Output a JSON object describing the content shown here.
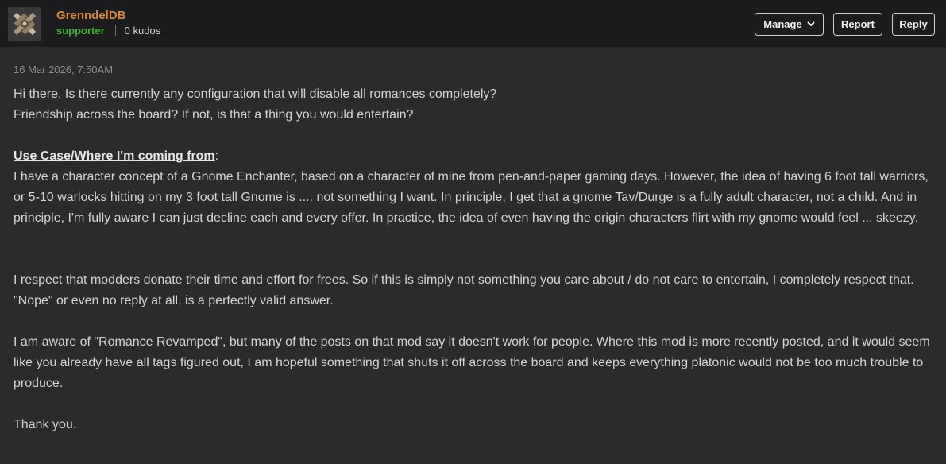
{
  "author": {
    "username": "GrenndelDB",
    "role": "supporter",
    "kudos": "0 kudos"
  },
  "actions": {
    "manage_label": "Manage",
    "report_label": "Report",
    "reply_label": "Reply"
  },
  "post": {
    "timestamp": "16 Mar 2026, 7:50AM",
    "line1": "Hi there. Is there currently any configuration that will disable all romances completely?",
    "line2": "Friendship across the board? If not, is that a thing you would entertain?",
    "heading": "Use Case/Where I'm coming from",
    "heading_suffix": ":",
    "para1": "I have a character concept of a Gnome Enchanter, based on a character of mine from pen-and-paper gaming days. However, the idea of having 6 foot tall warriors, or 5-10 warlocks hitting on my 3 foot tall Gnome is .... not something I want. In principle, I get that a gnome Tav/Durge is a fully adult character, not a child. And in principle, I'm fully aware I can just decline each and every offer. In practice, the idea of even having the origin characters flirt with my gnome would feel ... skeezy.",
    "para2": "I respect that modders donate their time and effort for frees. So if this is simply not something you care about / do not care to entertain, I completely respect that. \"Nope\" or even no reply at all, is a perfectly valid answer.",
    "para3": "I am aware of \"Romance Revamped\", but many of the posts on that mod say it doesn't work for people. Where this mod is more recently posted, and it would seem like you already have all tags figured out, I am hopeful something that shuts it off across the board and keeps everything platonic would not be too much trouble to produce.",
    "closing": "Thank you."
  }
}
